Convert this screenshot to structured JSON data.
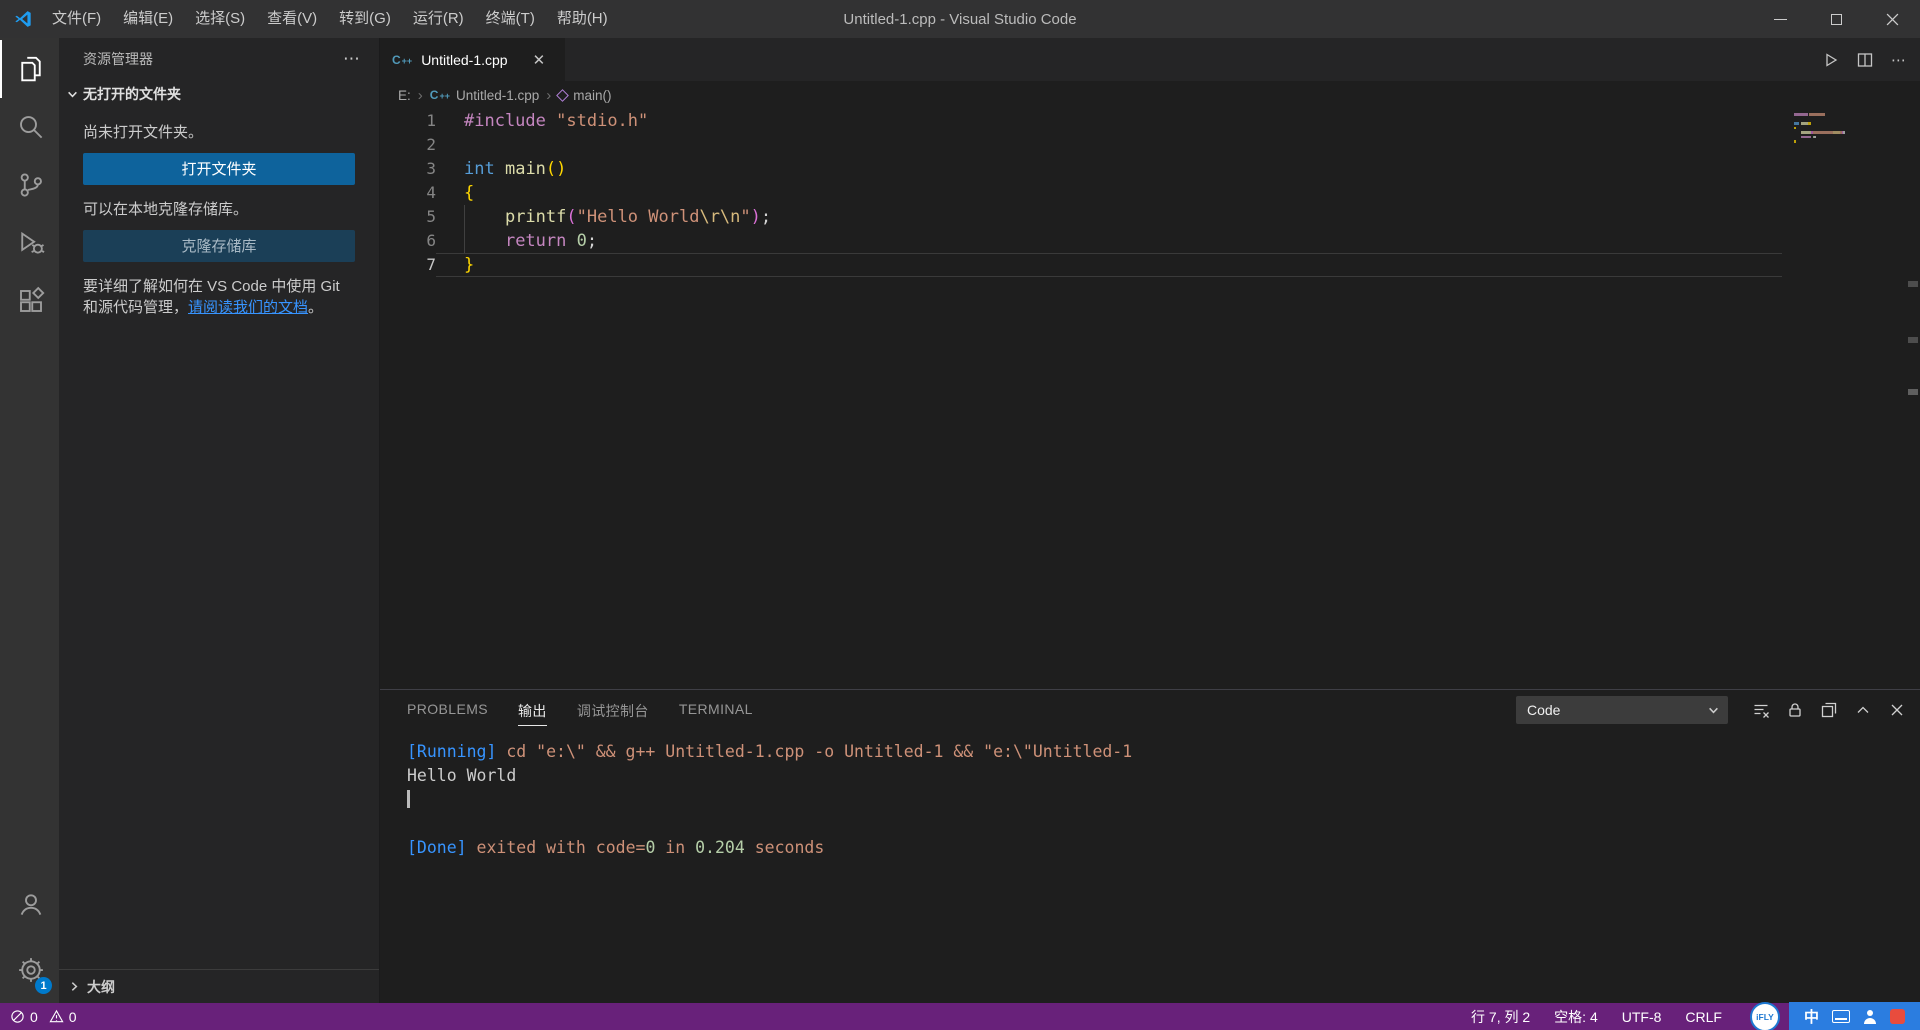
{
  "colors": {
    "accent_blue": "#0E639C",
    "link_blue": "#3794FF",
    "status_bar": "#68217A",
    "badge_blue": "#007ACC",
    "token_preprocessor": "#C586C0",
    "token_keyword": "#569CD6",
    "token_function": "#DCDCAA",
    "token_string": "#CE9178",
    "token_escape": "#D7BA7D",
    "token_number": "#B5CEA8",
    "token_control": "#C586C0",
    "token_default": "#D4D4D4",
    "bracket_gold": "#FFD700",
    "bracket_pink": "#DA70D6",
    "log_info": "#3794FF",
    "log_orange": "#CE9178",
    "log_number": "#B5CEA8"
  },
  "title_bar": {
    "title": "Untitled-1.cpp - Visual Studio Code",
    "menus": [
      "文件(F)",
      "编辑(E)",
      "选择(S)",
      "查看(V)",
      "转到(G)",
      "运行(R)",
      "终端(T)",
      "帮助(H)"
    ]
  },
  "activity_bar": {
    "settings_badge": "1"
  },
  "sidebar": {
    "title": "资源管理器",
    "section_title": "无打开的文件夹",
    "no_folder_text": "尚未打开文件夹。",
    "open_folder_button": "打开文件夹",
    "clone_text": "可以在本地克隆存储库。",
    "clone_button": "克隆存储库",
    "doc_text_before": "要详细了解如何在 VS Code 中使用 Git 和源代码管理，",
    "doc_link": "请阅读我们的文档",
    "doc_text_after": "。",
    "outline_title": "大纲"
  },
  "editor": {
    "tab_label": "Untitled-1.cpp",
    "breadcrumb": [
      {
        "label": "E:",
        "icon": ""
      },
      {
        "label": "Untitled-1.cpp",
        "icon": "cpp"
      },
      {
        "label": "main()",
        "icon": "method"
      }
    ],
    "current_line": 7,
    "code_lines": [
      [
        {
          "t": "#include",
          "c": "pp"
        },
        {
          "t": " ",
          "c": "d"
        },
        {
          "t": "\"stdio.h\"",
          "c": "str"
        }
      ],
      [],
      [
        {
          "t": "int",
          "c": "kw"
        },
        {
          "t": " ",
          "c": "d"
        },
        {
          "t": "main",
          "c": "fn"
        },
        {
          "t": "()",
          "c": "b1"
        }
      ],
      [
        {
          "t": "{",
          "c": "b1"
        }
      ],
      [
        {
          "t": "    ",
          "c": "d"
        },
        {
          "t": "printf",
          "c": "fn"
        },
        {
          "t": "(",
          "c": "b2"
        },
        {
          "t": "\"Hello World",
          "c": "str"
        },
        {
          "t": "\\r\\n",
          "c": "esc"
        },
        {
          "t": "\"",
          "c": "str"
        },
        {
          "t": ")",
          "c": "b2"
        },
        {
          "t": ";",
          "c": "d"
        }
      ],
      [
        {
          "t": "    ",
          "c": "d"
        },
        {
          "t": "return",
          "c": "ctrl"
        },
        {
          "t": " ",
          "c": "d"
        },
        {
          "t": "0",
          "c": "num"
        },
        {
          "t": ";",
          "c": "d"
        }
      ],
      [
        {
          "t": "}",
          "c": "b1"
        }
      ]
    ]
  },
  "panel": {
    "tabs": [
      {
        "label": "PROBLEMS",
        "active": false
      },
      {
        "label": "输出",
        "active": true
      },
      {
        "label": "调试控制台",
        "active": false
      },
      {
        "label": "TERMINAL",
        "active": false
      }
    ],
    "channel": "Code",
    "output_lines": [
      [
        {
          "t": "[Running] ",
          "c": "info"
        },
        {
          "t": "cd \"e:\\\" && g++ Untitled-1.cpp -o Untitled-1 && \"e:\\\"Untitled-1",
          "c": "cmd"
        }
      ],
      [
        {
          "t": "Hello World",
          "c": "plain"
        }
      ],
      [
        {
          "t": "",
          "c": "cursor"
        }
      ],
      [],
      [
        {
          "t": "[Done] ",
          "c": "info"
        },
        {
          "t": "exited with ",
          "c": "cmd"
        },
        {
          "t": "code=",
          "c": "cmd"
        },
        {
          "t": "0",
          "c": "num2"
        },
        {
          "t": " in ",
          "c": "cmd"
        },
        {
          "t": "0.204",
          "c": "num2"
        },
        {
          "t": " seconds",
          "c": "cmd"
        }
      ]
    ]
  },
  "status_bar": {
    "errors": "0",
    "warnings": "0",
    "cursor_position": "行 7, 列 2",
    "indentation": "空格: 4",
    "encoding": "UTF-8",
    "eol": "CRLF",
    "ime_mode": "中",
    "ime_brand": "iFLY"
  }
}
